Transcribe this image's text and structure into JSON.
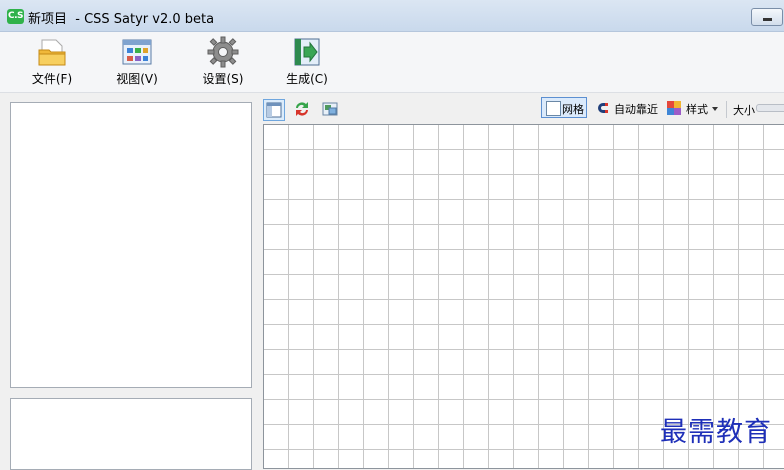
{
  "window": {
    "app_icon_text": "C.S",
    "title": "新项目  - CSS Satyr v2.0 beta"
  },
  "ribbon": {
    "items": [
      {
        "label": "文件(F)",
        "icon": "folder-icon"
      },
      {
        "label": "视图(V)",
        "icon": "view-grid-icon"
      },
      {
        "label": "设置(S)",
        "icon": "gear-icon"
      },
      {
        "label": "生成(C)",
        "icon": "export-icon"
      }
    ]
  },
  "canvas_toolbar": {
    "grid_label": "网格",
    "snap_label": "自动靠近",
    "style_label": "样式",
    "size_label": "大小"
  },
  "watermark": "最需教育",
  "colors": {
    "accent": "#2fb24a",
    "grid_line": "#c7c7c7",
    "watermark": "#1e2fb8"
  }
}
